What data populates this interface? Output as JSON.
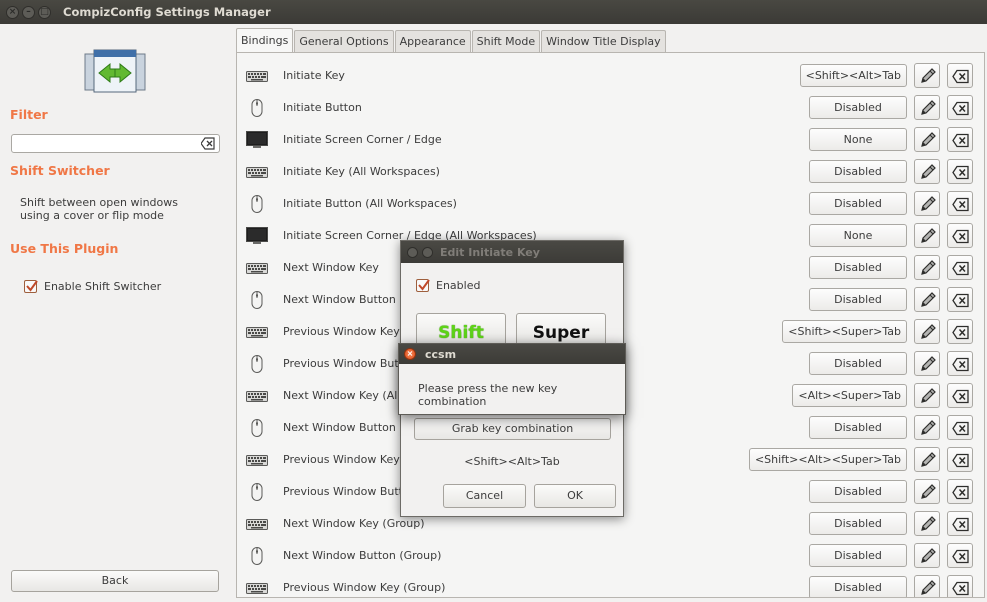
{
  "window": {
    "title": "CompizConfig Settings Manager",
    "controls": [
      "close",
      "minimize",
      "maximize"
    ]
  },
  "sidebar": {
    "filter_heading": "Filter",
    "filter_value": "",
    "plugin_heading": "Shift Switcher",
    "plugin_description": "Shift between open windows using a cover or flip mode",
    "use_heading": "Use This Plugin",
    "enable_label": "Enable Shift Switcher",
    "enable_checked": true,
    "back_label": "Back"
  },
  "tabs": [
    {
      "label": "Bindings",
      "active": true
    },
    {
      "label": "General Options",
      "active": false
    },
    {
      "label": "Appearance",
      "active": false
    },
    {
      "label": "Shift Mode",
      "active": false
    },
    {
      "label": "Window Title Display",
      "active": false
    }
  ],
  "bindings": [
    {
      "icon": "keyboard-icon",
      "name": "Initiate Key",
      "value": "<Shift><Alt>Tab"
    },
    {
      "icon": "mouse-icon",
      "name": "Initiate Button",
      "value": "Disabled"
    },
    {
      "icon": "monitor-icon",
      "name": "Initiate Screen Corner / Edge",
      "value": "None"
    },
    {
      "icon": "keyboard-icon",
      "name": "Initiate Key (All Workspaces)",
      "value": "Disabled"
    },
    {
      "icon": "mouse-icon",
      "name": "Initiate Button (All Workspaces)",
      "value": "Disabled"
    },
    {
      "icon": "monitor-icon",
      "name": "Initiate Screen Corner / Edge (All Workspaces)",
      "value": "None"
    },
    {
      "icon": "keyboard-icon",
      "name": "Next Window Key",
      "value": "Disabled"
    },
    {
      "icon": "mouse-icon",
      "name": "Next Window Button",
      "value": "Disabled"
    },
    {
      "icon": "keyboard-icon",
      "name": "Previous Window Key",
      "value": "<Shift><Super>Tab"
    },
    {
      "icon": "mouse-icon",
      "name": "Previous Window Button",
      "value": "Disabled"
    },
    {
      "icon": "keyboard-icon",
      "name": "Next Window Key (All Workspaces)",
      "value": "<Alt><Super>Tab"
    },
    {
      "icon": "mouse-icon",
      "name": "Next Window Button (All Workspaces)",
      "value": "Disabled"
    },
    {
      "icon": "keyboard-icon",
      "name": "Previous Window Key (All Workspaces)",
      "value": "<Shift><Alt><Super>Tab"
    },
    {
      "icon": "mouse-icon",
      "name": "Previous Window Button (All Workspaces)",
      "value": "Disabled"
    },
    {
      "icon": "keyboard-icon",
      "name": "Next Window Key (Group)",
      "value": "Disabled"
    },
    {
      "icon": "mouse-icon",
      "name": "Next Window Button (Group)",
      "value": "Disabled"
    },
    {
      "icon": "keyboard-icon",
      "name": "Previous Window Key (Group)",
      "value": "Disabled"
    }
  ],
  "edit_dialog": {
    "title": "Edit Initiate Key",
    "enabled_label": "Enabled",
    "enabled_checked": true,
    "modifier_shift": "Shift",
    "modifier_super": "Super",
    "grab_label": "Grab key combination",
    "current_combo": "<Shift><Alt>Tab",
    "cancel_label": "Cancel",
    "ok_label": "OK"
  },
  "grab_dialog": {
    "title": "ccsm",
    "message": "Please press the new key combination"
  },
  "colors": {
    "accent": "#f07746",
    "shift_active": "#5ed418",
    "titlebar": "#3c3b37"
  }
}
